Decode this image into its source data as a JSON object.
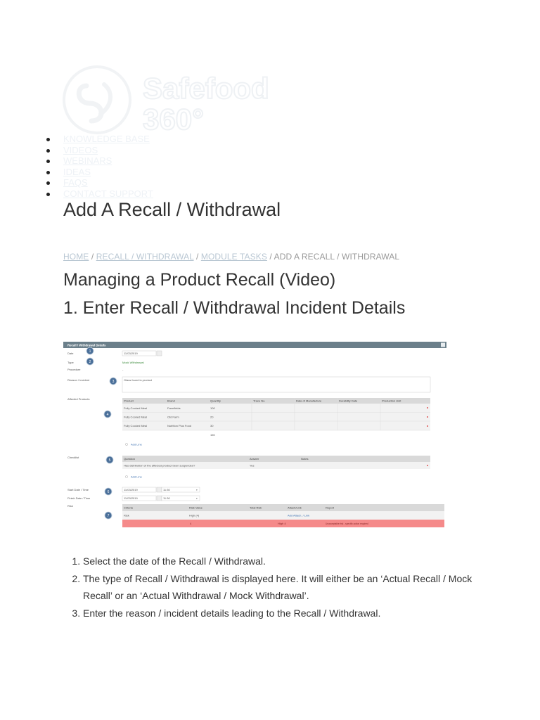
{
  "logo": {
    "line1": "Safefood",
    "line2": "360°"
  },
  "nav": [
    {
      "label": "KNOWLEDGE BASE"
    },
    {
      "label": "VIDEOS"
    },
    {
      "label": "WEBINARS"
    },
    {
      "label": "IDEAS"
    },
    {
      "label": "FAQS"
    },
    {
      "label": "CONTACT SUPPORT"
    }
  ],
  "page": {
    "title": "Add A Recall / Withdrawal",
    "breadcrumb": {
      "home": "HOME",
      "sep": " / ",
      "recall": "RECALL / WITHDRAWAL",
      "module": "MODULE TASKS",
      "current": "ADD A RECALL / WITHDRAWAL"
    },
    "heading_video": "Managing a Product Recall (Video)",
    "heading_step1": "1. Enter Recall / Withdrawal Incident Details"
  },
  "screenshot": {
    "header": "Recall / Withdrawal Details",
    "labels": {
      "date": "Date",
      "type": "Type",
      "procedure": "Procedure",
      "reason": "Reason / Incident",
      "products": "Affected Products",
      "checklist": "Checklist",
      "start": "Start Date / Time",
      "finish": "Finish Date / Time",
      "risk": "Risk"
    },
    "values": {
      "date": "11/03/2019",
      "type": "Mock Withdrawal",
      "procedure": "-",
      "reason": "Glass found in product",
      "start_date": "11/03/2019",
      "start_time": "11:30",
      "finish_date": "11/03/2019",
      "finish_time": "11:30"
    },
    "products_table": {
      "headers": [
        "Product",
        "Brand",
        "Quantity",
        "Trace No.",
        "Date of Manufacture",
        "Durability Date",
        "Production Unit"
      ],
      "rows": [
        [
          "Fully Cooked Meal",
          "Farmfields",
          "100"
        ],
        [
          "Fully Cooked Meal",
          "Old Farm",
          "20"
        ],
        [
          "Fully Cooked Meal",
          "Nutrition Plus Food",
          "30"
        ]
      ],
      "total": "150",
      "add_line": "Add Line"
    },
    "checklist_table": {
      "headers": [
        "Question",
        "Answer",
        "Notes"
      ],
      "row": [
        "Has distribution of the affected product been suspended?",
        "Yes"
      ],
      "add_line": "Add Line"
    },
    "risk_table": {
      "headers": [
        "Criteria",
        "Risk Value",
        "Total Risk",
        "Attach/Link",
        "Report"
      ],
      "row": [
        "Risk",
        "High (4)",
        "",
        "Add Attach. / Link"
      ],
      "total_row": [
        "4",
        "High 4",
        "Unacceptable risk - specific action required"
      ]
    },
    "markers": [
      "1",
      "2",
      "3",
      "4",
      "5",
      "6",
      "7"
    ],
    "colors": {
      "header": "#6b7f8a",
      "marker": "#4a6f99",
      "risk": "#f58a8a"
    }
  },
  "steps": [
    "Select the date of the Recall / Withdrawal.",
    "The type of Recall / Withdrawal is displayed here. It will either be an ‘Actual Recall / Mock Recall’ or an ‘Actual Withdrawal / Mock Withdrawal’.",
    "Enter the reason / incident details leading to the Recall / Withdrawal."
  ]
}
